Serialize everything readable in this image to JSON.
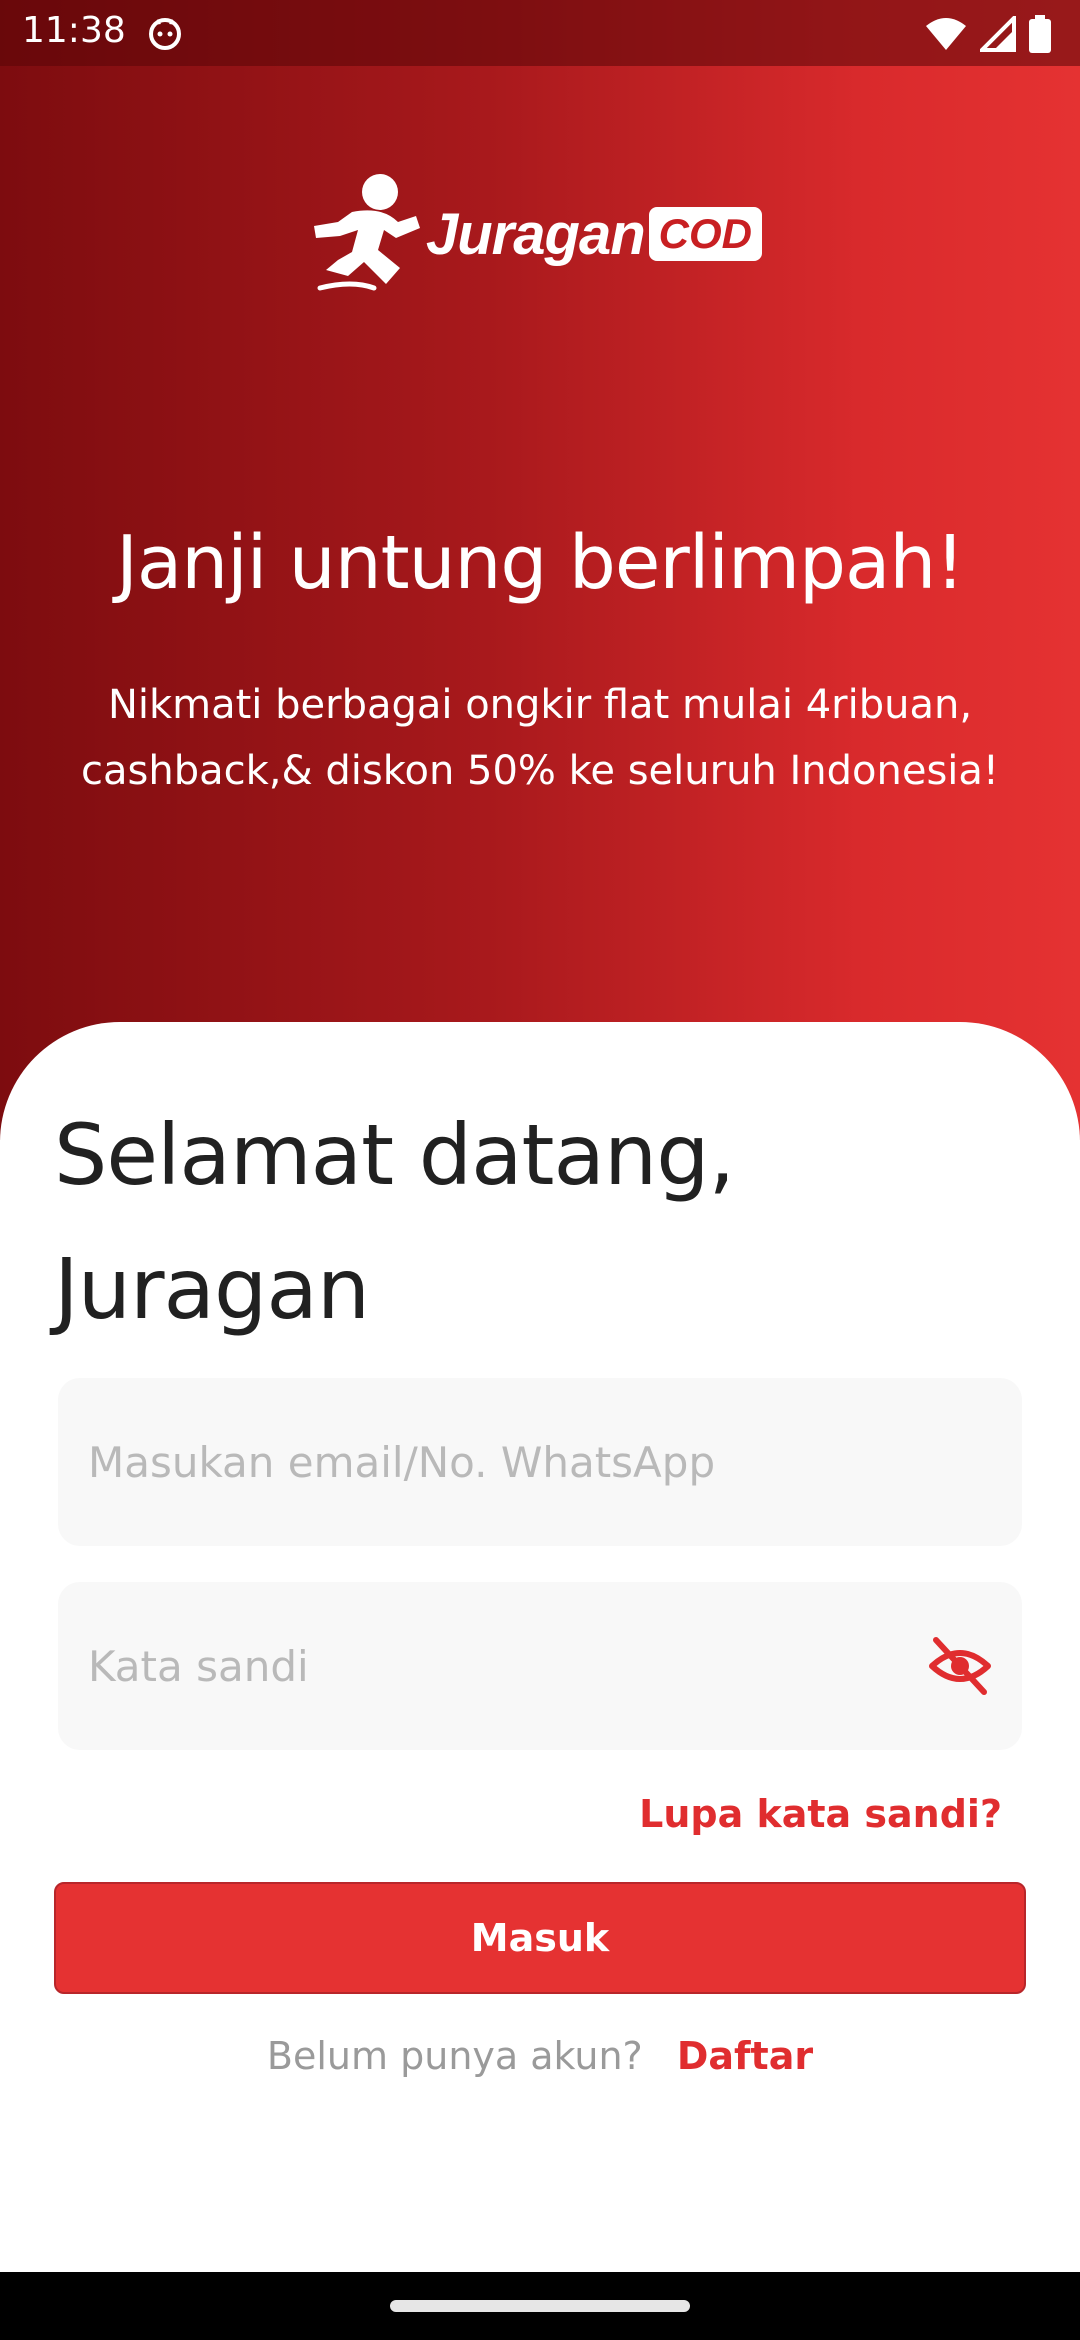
{
  "status_bar": {
    "time": "11:38",
    "icons": [
      "notification-face-icon",
      "wifi-icon",
      "signal-icon",
      "battery-icon"
    ]
  },
  "brand": {
    "name_script": "Juragan",
    "name_badge": "COD"
  },
  "hero": {
    "title": "Janji untung berlimpah!",
    "subtitle": "Nikmati berbagai ongkir flat mulai 4ribuan, cashback,& diskon 50% ke seluruh Indonesia!"
  },
  "login": {
    "welcome": "Selamat datang, Juragan",
    "email_placeholder": "Masukan email/No. WhatsApp",
    "password_placeholder": "Kata sandi",
    "forgot_label": "Lupa kata sandi?",
    "submit_label": "Masuk",
    "register_question": "Belum punya akun?",
    "register_link": "Daftar"
  },
  "colors": {
    "primary": "#e53232",
    "primary_dark": "#7d0c0f",
    "text_dark": "#212121",
    "placeholder": "#b9b9b9",
    "field_bg": "#f8f8f8"
  }
}
